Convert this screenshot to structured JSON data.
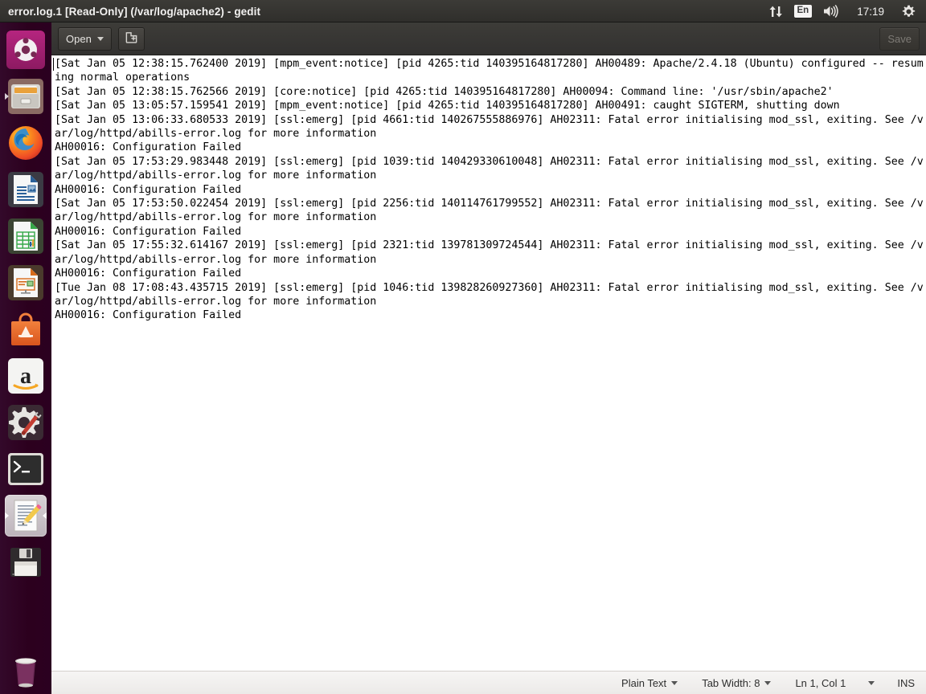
{
  "panel": {
    "title": "error.log.1 [Read-Only] (/var/log/apache2) - gedit",
    "indicators": {
      "network_icon": "network-updown-icon",
      "keyboard_layout": "En",
      "volume_icon": "volume-icon",
      "clock": "17:19",
      "system_icon": "gear-icon"
    }
  },
  "launcher": {
    "items": [
      {
        "name": "ubuntu-dash",
        "label": "Ubuntu Dash"
      },
      {
        "name": "files",
        "label": "Files"
      },
      {
        "name": "firefox",
        "label": "Firefox Web Browser"
      },
      {
        "name": "libreoffice-writer",
        "label": "LibreOffice Writer"
      },
      {
        "name": "libreoffice-calc",
        "label": "LibreOffice Calc"
      },
      {
        "name": "libreoffice-impress",
        "label": "LibreOffice Impress"
      },
      {
        "name": "ubuntu-software",
        "label": "Ubuntu Software"
      },
      {
        "name": "amazon",
        "label": "Amazon"
      },
      {
        "name": "system-settings",
        "label": "System Settings"
      },
      {
        "name": "terminal",
        "label": "Terminal"
      },
      {
        "name": "gedit",
        "label": "gedit Text Editor"
      },
      {
        "name": "disk-drive",
        "label": "Floppy Disk Drive"
      },
      {
        "name": "trash",
        "label": "Trash"
      }
    ]
  },
  "headerbar": {
    "open_label": "Open",
    "new_document_icon": "new-document-icon",
    "save_label": "Save"
  },
  "document": {
    "text": "[Sat Jan 05 12:38:15.762400 2019] [mpm_event:notice] [pid 4265:tid 140395164817280] AH00489: Apache/2.4.18 (Ubuntu) configured -- resuming normal operations\n[Sat Jan 05 12:38:15.762566 2019] [core:notice] [pid 4265:tid 140395164817280] AH00094: Command line: '/usr/sbin/apache2'\n[Sat Jan 05 13:05:57.159541 2019] [mpm_event:notice] [pid 4265:tid 140395164817280] AH00491: caught SIGTERM, shutting down\n[Sat Jan 05 13:06:33.680533 2019] [ssl:emerg] [pid 4661:tid 140267555886976] AH02311: Fatal error initialising mod_ssl, exiting. See /var/log/httpd/abills-error.log for more information\nAH00016: Configuration Failed\n[Sat Jan 05 17:53:29.983448 2019] [ssl:emerg] [pid 1039:tid 140429330610048] AH02311: Fatal error initialising mod_ssl, exiting. See /var/log/httpd/abills-error.log for more information\nAH00016: Configuration Failed\n[Sat Jan 05 17:53:50.022454 2019] [ssl:emerg] [pid 2256:tid 140114761799552] AH02311: Fatal error initialising mod_ssl, exiting. See /var/log/httpd/abills-error.log for more information\nAH00016: Configuration Failed\n[Sat Jan 05 17:55:32.614167 2019] [ssl:emerg] [pid 2321:tid 139781309724544] AH02311: Fatal error initialising mod_ssl, exiting. See /var/log/httpd/abills-error.log for more information\nAH00016: Configuration Failed\n[Tue Jan 08 17:08:43.435715 2019] [ssl:emerg] [pid 1046:tid 139828260927360] AH02311: Fatal error initialising mod_ssl, exiting. See /var/log/httpd/abills-error.log for more information\nAH00016: Configuration Failed\n"
  },
  "statusbar": {
    "language": "Plain Text",
    "tab_width": "Tab Width: 8",
    "position": "Ln 1, Col 1",
    "insert_mode": "INS"
  },
  "colors": {
    "launcher_bg": "#2c001e",
    "panel_bg": "#33322e",
    "headerbar_bg": "#3a3935",
    "text_bg": "#ffffff",
    "text_fg": "#000000",
    "statusbar_bg": "#f1efed"
  }
}
